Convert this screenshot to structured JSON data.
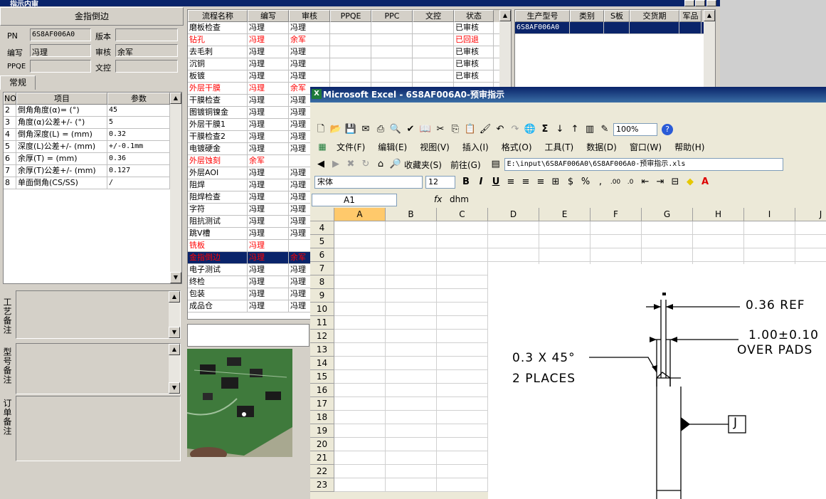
{
  "window": {
    "title": "指示内审"
  },
  "left": {
    "heading": "金指倒边",
    "pn_label": "PN",
    "pn_value": "6S8AF006A0",
    "version_label": "版本",
    "version_value": "",
    "author_label": "编写",
    "author_value": "冯理",
    "reviewer_label": "审核",
    "reviewer_value": "余军",
    "ppqe_label": "PPQE",
    "ppqe_value": "",
    "doc_label": "文控",
    "doc_value": "",
    "tab": "常规",
    "params_headers": [
      "NO",
      "项目",
      "参数"
    ],
    "params": [
      {
        "no": "2",
        "item": "倒角角度(α)=  (°)",
        "value": "45"
      },
      {
        "no": "3",
        "item": "角度(α)公差+/-  (°)",
        "value": "5"
      },
      {
        "no": "4",
        "item": "倒角深度(L) =  (mm)",
        "value": "0.32"
      },
      {
        "no": "5",
        "item": "深度(L)公差+/-  (mm)",
        "value": "+/-0.1mm"
      },
      {
        "no": "6",
        "item": "余厚(T) =  (mm)",
        "value": "0.36"
      },
      {
        "no": "7",
        "item": "余厚(T)公差+/-  (mm)",
        "value": "0.127"
      },
      {
        "no": "8",
        "item": "单面倒角(CS/SS)",
        "value": "/"
      }
    ],
    "note1": "工艺备注",
    "note2": "型号备注",
    "note3": "订单备注"
  },
  "flow": {
    "headers": [
      "流程名称",
      "编写",
      "审核",
      "PPQE",
      "PPC",
      "文控",
      "状态"
    ],
    "rows": [
      {
        "name": "磨板检查",
        "author": "冯理",
        "reviewer": "冯理",
        "status": "已审核",
        "style": "normal"
      },
      {
        "name": "钻孔",
        "author": "冯理",
        "reviewer": "余军",
        "status": "已回退",
        "style": "red"
      },
      {
        "name": "去毛刺",
        "author": "冯理",
        "reviewer": "冯理",
        "status": "已审核",
        "style": "normal"
      },
      {
        "name": "沉铜",
        "author": "冯理",
        "reviewer": "冯理",
        "status": "已审核",
        "style": "normal"
      },
      {
        "name": "板镀",
        "author": "冯理",
        "reviewer": "冯理",
        "status": "已审核",
        "style": "normal"
      },
      {
        "name": "外层干膜",
        "author": "冯理",
        "reviewer": "余军",
        "status": "",
        "style": "red"
      },
      {
        "name": "干膜检查",
        "author": "冯理",
        "reviewer": "冯理",
        "status": "",
        "style": "normal"
      },
      {
        "name": "图镀铜镍金",
        "author": "冯理",
        "reviewer": "冯理",
        "status": "",
        "style": "normal"
      },
      {
        "name": "外层干膜1",
        "author": "冯理",
        "reviewer": "冯理",
        "status": "",
        "style": "normal"
      },
      {
        "name": "干膜检查2",
        "author": "冯理",
        "reviewer": "冯理",
        "status": "",
        "style": "normal"
      },
      {
        "name": "电镀硬金",
        "author": "冯理",
        "reviewer": "冯理",
        "status": "",
        "style": "normal"
      },
      {
        "name": "外层蚀刻",
        "author": "余军",
        "reviewer": "",
        "status": "",
        "style": "red"
      },
      {
        "name": "外层AOI",
        "author": "冯理",
        "reviewer": "冯理",
        "status": "",
        "style": "normal"
      },
      {
        "name": "阻焊",
        "author": "冯理",
        "reviewer": "冯理",
        "status": "",
        "style": "normal"
      },
      {
        "name": "阻焊检查",
        "author": "冯理",
        "reviewer": "冯理",
        "status": "",
        "style": "normal"
      },
      {
        "name": "字符",
        "author": "冯理",
        "reviewer": "冯理",
        "status": "",
        "style": "normal"
      },
      {
        "name": "阻抗测试",
        "author": "冯理",
        "reviewer": "冯理",
        "status": "",
        "style": "normal"
      },
      {
        "name": "跳V槽",
        "author": "冯理",
        "reviewer": "冯理",
        "status": "",
        "style": "normal"
      },
      {
        "name": "铣板",
        "author": "冯理",
        "reviewer": "",
        "status": "",
        "style": "red"
      },
      {
        "name": "金指倒边",
        "author": "冯理",
        "reviewer": "余军",
        "status": "",
        "style": "selected"
      },
      {
        "name": "电子测试",
        "author": "冯理",
        "reviewer": "冯理",
        "status": "",
        "style": "normal"
      },
      {
        "name": "终检",
        "author": "冯理",
        "reviewer": "冯理",
        "status": "",
        "style": "normal"
      },
      {
        "name": "包装",
        "author": "冯理",
        "reviewer": "冯理",
        "status": "",
        "style": "normal"
      },
      {
        "name": "成品仓",
        "author": "冯理",
        "reviewer": "冯理",
        "status": "",
        "style": "normal"
      }
    ]
  },
  "prod": {
    "headers": [
      "生产型号",
      "类别",
      "S板",
      "交货期",
      "军品"
    ],
    "row": "6S8AF006A0"
  },
  "excel": {
    "title": "Microsoft Excel - 6S8AF006A0-预审指示",
    "menu": [
      "文件(F)",
      "编辑(E)",
      "视图(V)",
      "插入(I)",
      "格式(O)",
      "工具(T)",
      "数据(D)",
      "窗口(W)",
      "帮助(H)"
    ],
    "zoom": "100%",
    "favorites": "收藏夹(S)",
    "goto": "前往(G)",
    "path": "E:\\input\\6S8AF006A0\\6S8AF006A0-预审指示.xls",
    "font": "宋体",
    "font_size": "12",
    "cell_ref": "A1",
    "fx": "fx",
    "formula": "dhm",
    "columns": [
      "A",
      "B",
      "C",
      "D",
      "E",
      "F",
      "G",
      "H",
      "I",
      "J"
    ],
    "rows": [
      "4",
      "5",
      "6",
      "7",
      "8",
      "9",
      "10",
      "11",
      "12",
      "13",
      "14",
      "15",
      "16",
      "17",
      "18",
      "19",
      "20",
      "21",
      "22",
      "23"
    ],
    "drawing": {
      "ref": "0.36  REF",
      "tol": "1.00±0.10",
      "over": "OVER PADS",
      "chamfer": "0.3 X 45°",
      "places": "2 PLACES",
      "datum": "J"
    }
  }
}
